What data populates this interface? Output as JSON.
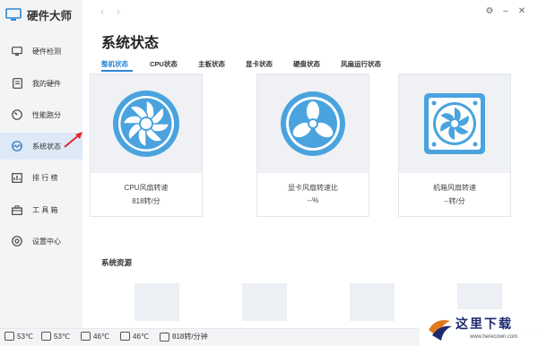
{
  "app": {
    "title": "硬件大师",
    "accent_color": "#2a86d8"
  },
  "sidebar": {
    "items": [
      {
        "label": "硬件检测",
        "icon": "monitor-icon",
        "active": false
      },
      {
        "label": "我的硬件",
        "icon": "document-icon",
        "active": false
      },
      {
        "label": "性能跑分",
        "icon": "gauge-icon",
        "active": false
      },
      {
        "label": "系统状态",
        "icon": "wave-icon",
        "active": true
      },
      {
        "label": "排 行 榜",
        "icon": "ranking-icon",
        "active": false
      },
      {
        "label": "工 具 箱",
        "icon": "toolbox-icon",
        "active": false
      },
      {
        "label": "设置中心",
        "icon": "settings-icon",
        "active": false
      }
    ]
  },
  "topbar": {
    "back": "‹",
    "forward": "›",
    "settings": "⚙",
    "minimize": "–",
    "close": "✕"
  },
  "main": {
    "title": "系统状态",
    "tabs": [
      {
        "label": "整机状态",
        "active": true
      },
      {
        "label": "CPU状态",
        "active": false
      },
      {
        "label": "主板状态",
        "active": false
      },
      {
        "label": "显卡状态",
        "active": false
      },
      {
        "label": "硬盘状态",
        "active": false
      },
      {
        "label": "风扇运行状态",
        "active": false
      }
    ],
    "cards": [
      {
        "name": "CPU风扇转速",
        "value": "818转/分",
        "icon": "cpu-fan-icon"
      },
      {
        "name": "显卡风扇转速比",
        "value": "--%",
        "icon": "gpu-fan-icon"
      },
      {
        "name": "机箱风扇转速",
        "value": "--转/分",
        "icon": "case-fan-icon"
      }
    ],
    "resources_title": "系统资源"
  },
  "statusbar": {
    "items": [
      {
        "icon": "cpu-temp-icon",
        "value": "53℃"
      },
      {
        "icon": "board-temp-icon",
        "value": "53℃"
      },
      {
        "icon": "gpu-temp-icon",
        "value": "46℃"
      },
      {
        "icon": "disk-temp-icon",
        "value": "46℃"
      },
      {
        "icon": "fan-speed-icon",
        "value": "818转/分钟"
      }
    ]
  },
  "watermark": {
    "text": "这里下载",
    "url": "www.herecown.com"
  }
}
